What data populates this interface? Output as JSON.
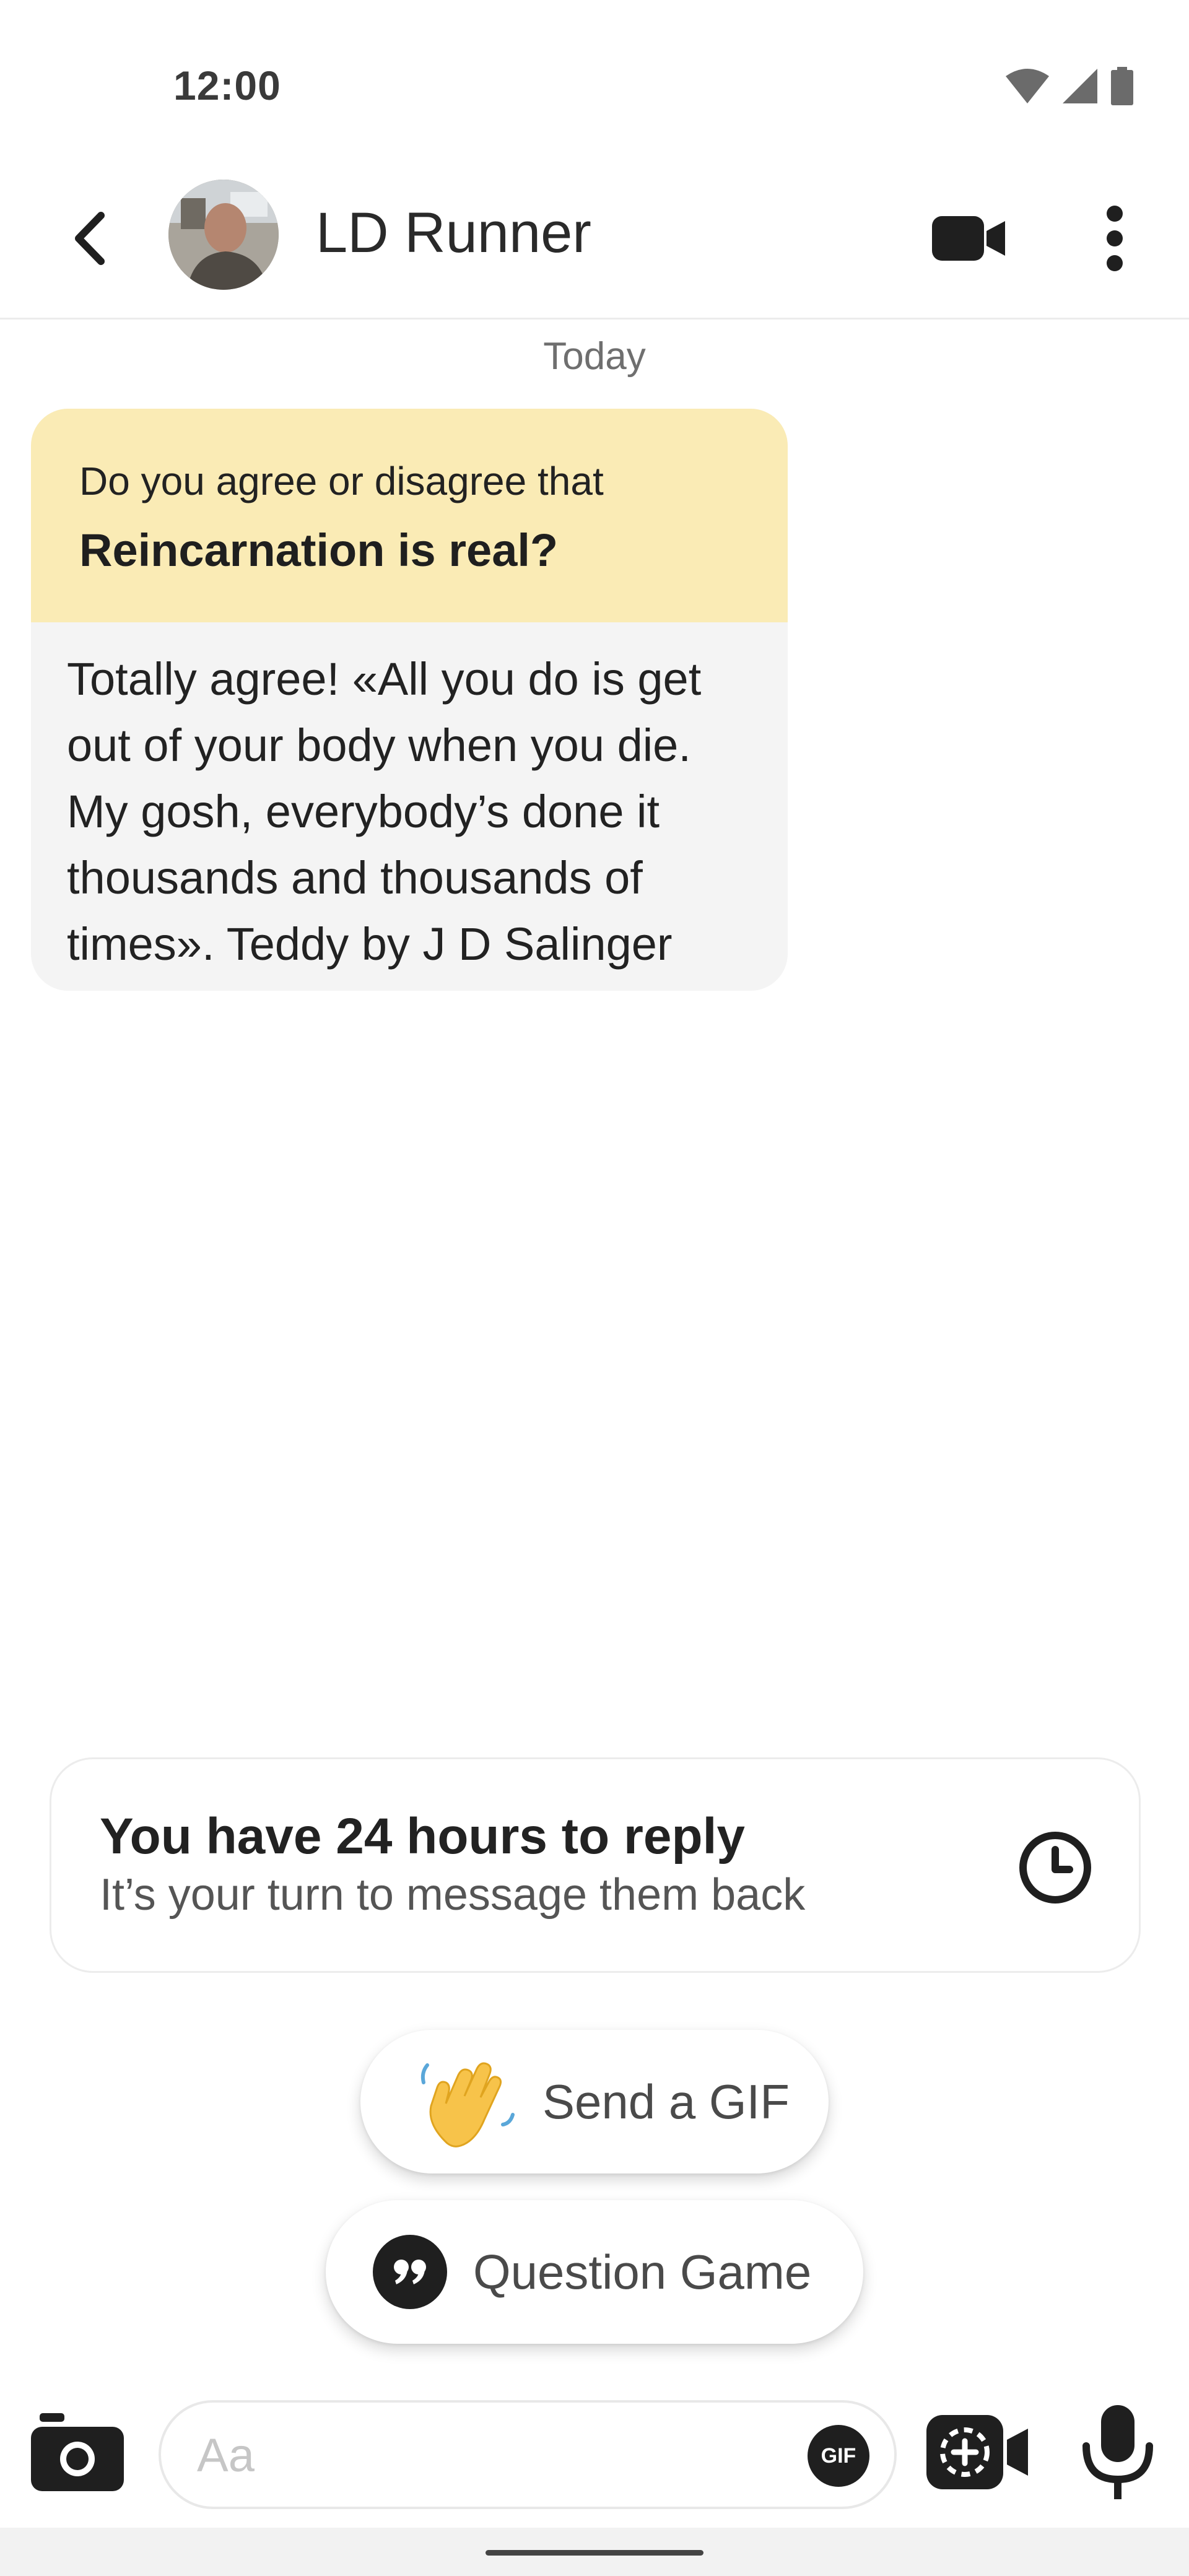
{
  "status_bar": {
    "time": "12:00"
  },
  "header": {
    "contact_name": "LD Runner"
  },
  "chat": {
    "date_separator": "Today",
    "question_card": {
      "prompt": "Do you agree or disagree that",
      "question": "Reincarnation is real?",
      "answer_lines": [
        "Totally agree! «All you do is get",
        "out of your body when you die.",
        "My gosh, everybody’s done it",
        "thousands and thousands of",
        "times». Teddy by J D Salinger"
      ]
    }
  },
  "reply_notice": {
    "title": "You have 24 hours to reply",
    "subtitle": "It’s your turn to message them back"
  },
  "suggestions": {
    "gif_label": "Send a GIF",
    "game_label": "Question Game"
  },
  "composer": {
    "placeholder": "Aa",
    "gif_badge": "GIF"
  },
  "colors": {
    "question_bg": "#faebb5",
    "answer_bg": "#f4f4f4",
    "icon_dark": "#1f1f1f"
  }
}
